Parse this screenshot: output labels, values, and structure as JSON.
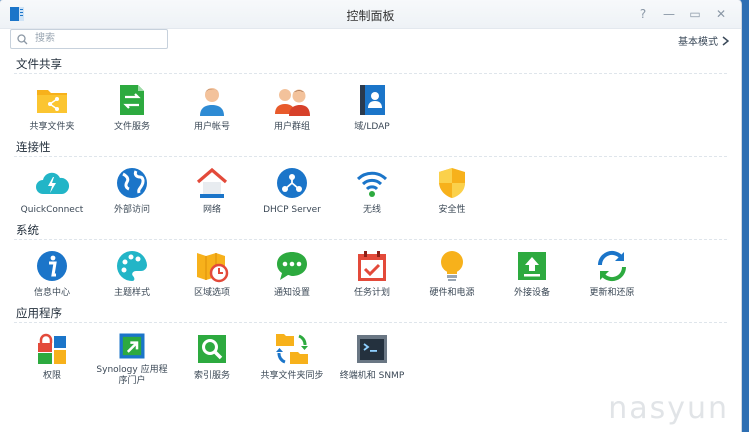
{
  "window": {
    "title": "控制面板"
  },
  "search": {
    "placeholder": "搜索"
  },
  "header": {
    "mode_label": "基本模式"
  },
  "sections": [
    {
      "title": "文件共享",
      "items": [
        {
          "label": "共享文件夹",
          "icon": "shared-folder-icon"
        },
        {
          "label": "文件服务",
          "icon": "file-services-icon"
        },
        {
          "label": "用户帐号",
          "icon": "user-icon"
        },
        {
          "label": "用户群组",
          "icon": "group-icon"
        },
        {
          "label": "域/LDAP",
          "icon": "domain-ldap-icon"
        }
      ]
    },
    {
      "title": "连接性",
      "items": [
        {
          "label": "QuickConnect",
          "icon": "quickconnect-icon"
        },
        {
          "label": "外部访问",
          "icon": "external-access-icon"
        },
        {
          "label": "网络",
          "icon": "network-icon"
        },
        {
          "label": "DHCP Server",
          "icon": "dhcp-server-icon"
        },
        {
          "label": "无线",
          "icon": "wireless-icon"
        },
        {
          "label": "安全性",
          "icon": "security-icon"
        }
      ]
    },
    {
      "title": "系统",
      "items": [
        {
          "label": "信息中心",
          "icon": "info-center-icon"
        },
        {
          "label": "主题样式",
          "icon": "theme-icon"
        },
        {
          "label": "区域选项",
          "icon": "regional-options-icon"
        },
        {
          "label": "通知设置",
          "icon": "notification-icon"
        },
        {
          "label": "任务计划",
          "icon": "task-scheduler-icon"
        },
        {
          "label": "硬件和电源",
          "icon": "hardware-power-icon"
        },
        {
          "label": "外接设备",
          "icon": "external-devices-icon"
        },
        {
          "label": "更新和还原",
          "icon": "update-restore-icon"
        }
      ]
    },
    {
      "title": "应用程序",
      "items": [
        {
          "label": "权限",
          "icon": "privileges-icon"
        },
        {
          "label": "Synology 应用程序门户",
          "icon": "app-portal-icon"
        },
        {
          "label": "索引服务",
          "icon": "indexing-service-icon"
        },
        {
          "label": "共享文件夹同步",
          "icon": "shared-folder-sync-icon"
        },
        {
          "label": "终端机和 SNMP",
          "icon": "terminal-snmp-icon"
        }
      ]
    }
  ],
  "watermark": {
    "text": "nasyun"
  },
  "colors": {
    "accent": "#1a7cc9",
    "background": "#3a7fc4"
  }
}
